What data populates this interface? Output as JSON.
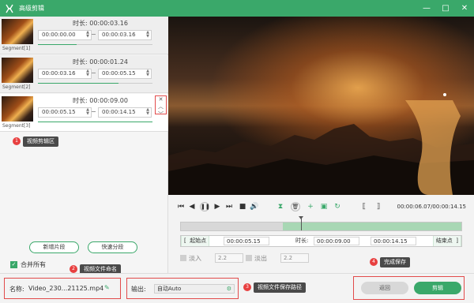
{
  "window": {
    "title": "高级剪辑",
    "controls": [
      "—",
      "□",
      "✕"
    ]
  },
  "segments": [
    {
      "label": "Segment[1]",
      "duration_label": "时长:",
      "duration": "00:00:03.16",
      "start": "00:00:00.00",
      "end": "00:00:03.16",
      "progress": 0.34
    },
    {
      "label": "Segment[2]",
      "duration_label": "时长:",
      "duration": "00:00:01.24",
      "start": "00:00:03.16",
      "end": "00:00:05.15",
      "progress": 0.7
    },
    {
      "label": "Segment[3]",
      "duration_label": "时长:",
      "duration": "00:00:09.00",
      "start": "00:00:05.15",
      "end": "00:00:14.15",
      "progress": 1.0
    }
  ],
  "segment_tools": {
    "close": "✕",
    "up": "︿",
    "down": "﹀"
  },
  "annotations": {
    "a1": {
      "num": "1",
      "text": "视频剪辑区"
    },
    "a2": {
      "num": "2",
      "text": "视频文件命名"
    },
    "a3": {
      "num": "3",
      "text": "视频文件保存路径"
    },
    "a4": {
      "num": "4",
      "text": "完成保存"
    }
  },
  "left_buttons": {
    "add": "新增片段",
    "split": "快速分段"
  },
  "merge": {
    "label": "合并所有",
    "check": "✓"
  },
  "player": {
    "time_current": "00:00:06.07",
    "time_total": "00:00:14.15",
    "time_display": "00:00:06.07/00:00:14.15"
  },
  "timeline": {
    "selection_start_fraction": 0.364,
    "selection_end_fraction": 1.0,
    "playhead_fraction": 0.429
  },
  "trim": {
    "start_btn": "起始点",
    "start_value": "00:00:05.15",
    "duration_label": "时长:",
    "duration_value": "00:00:09.00",
    "end_value": "00:00:14.15",
    "end_btn": "结束点",
    "bracket_left": "[",
    "bracket_right": "]"
  },
  "fade": {
    "in_label": "淡入",
    "in_value": "2.2",
    "out_label": "淡出",
    "out_value": "2.2"
  },
  "output": {
    "name_label": "名称:",
    "name_value": "Video_230...21125.mp4",
    "path_label": "输出:",
    "path_value": "自动Auto"
  },
  "actions": {
    "back": "返回",
    "save": "剪辑"
  },
  "colors": {
    "accent": "#3aa86a",
    "annotation_red": "#e84040",
    "callout_bg": "#4a4a4a"
  }
}
